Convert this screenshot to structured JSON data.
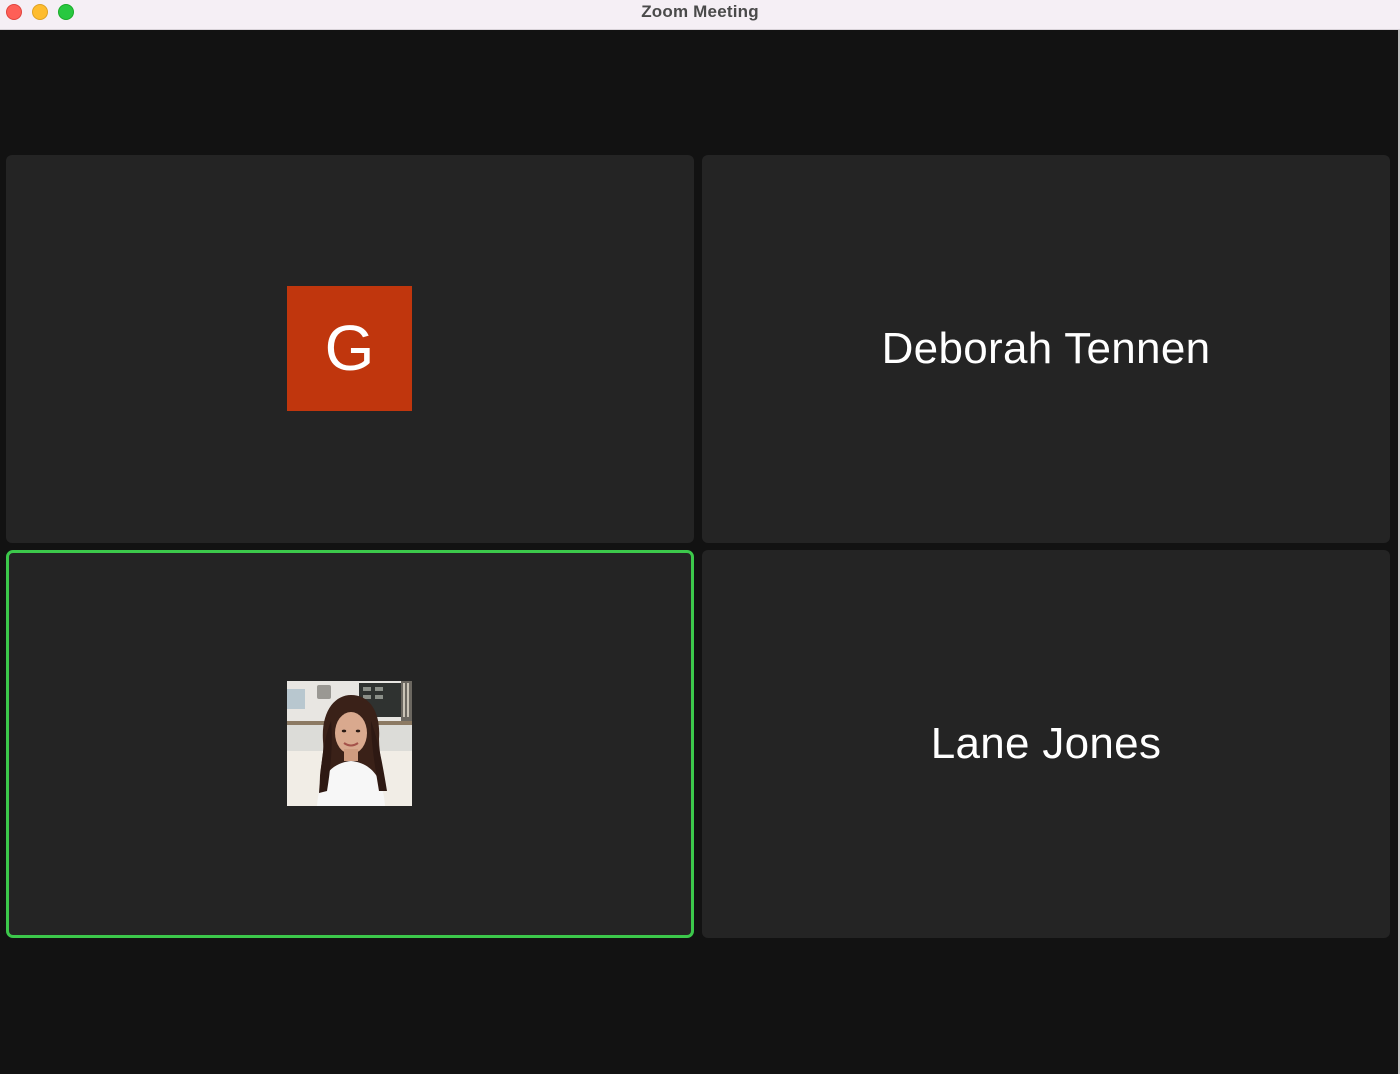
{
  "window": {
    "title": "Zoom Meeting"
  },
  "participants": [
    {
      "name": "",
      "avatar_initial": "G",
      "avatar_color": "#c0360d"
    },
    {
      "name": "Deborah Tennen"
    },
    {
      "name": "",
      "avatar": "photo-avatar",
      "speaking": true
    },
    {
      "name": "Lane Jones"
    }
  ],
  "colors": {
    "stage_background": "#121212",
    "tile_background": "#242424",
    "active_speaker_border": "#3cc84b",
    "titlebar_background": "#f5eff5"
  }
}
